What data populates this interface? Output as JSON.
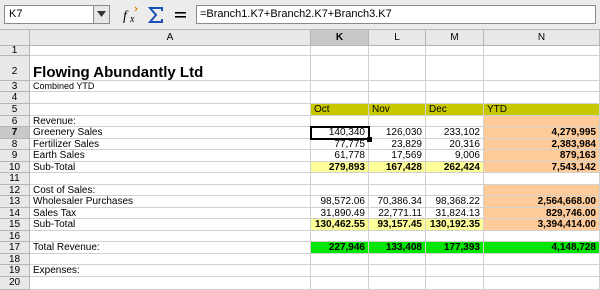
{
  "formula_bar": {
    "cell_ref": "K7",
    "formula": "=Branch1.K7+Branch2.K7+Branch3.K7",
    "icons": [
      "function-wizard-icon",
      "sum-icon",
      "equals-icon"
    ]
  },
  "colors": {
    "header_yellow": "#c8c800",
    "ytd_orange": "#ffcc99",
    "subtotal_yellow": "#ffff99",
    "total_green": "#00e600"
  },
  "columns": [
    "A",
    "K",
    "L",
    "M",
    "N"
  ],
  "rows": [
    "1",
    "2",
    "3",
    "4",
    "5",
    "6",
    "7",
    "8",
    "9",
    "10",
    "11",
    "12",
    "13",
    "14",
    "15",
    "16",
    "17",
    "18",
    "19",
    "20"
  ],
  "sheet": {
    "title": "Flowing Abundantly Ltd",
    "subtitle": "Combined YTD",
    "period_headers": [
      "Oct",
      "Nov",
      "Dec",
      "YTD"
    ],
    "revenue_label": "Revenue:",
    "revenue_rows": [
      {
        "label": "Greenery Sales",
        "k": "140,340",
        "l": "126,030",
        "m": "233,102",
        "n": "4,279,995"
      },
      {
        "label": "Fertilizer Sales",
        "k": "77,775",
        "l": "23,829",
        "m": "20,316",
        "n": "2,383,984"
      },
      {
        "label": "Earth Sales",
        "k": "61,778",
        "l": "17,569",
        "m": "9,006",
        "n": "879,163"
      }
    ],
    "revenue_subtotal": {
      "label": "Sub-Total",
      "k": "279,893",
      "l": "167,428",
      "m": "262,424",
      "n": "7,543,142"
    },
    "cost_label": "Cost of Sales:",
    "cost_rows": [
      {
        "label": "Wholesaler Purchases",
        "k": "98,572.06",
        "l": "70,386.34",
        "m": "98,368.22",
        "n": "2,564,668.00"
      },
      {
        "label": "Sales Tax",
        "k": "31,890.49",
        "l": "22,771.11",
        "m": "31,824.13",
        "n": "829,746.00"
      }
    ],
    "cost_subtotal": {
      "label": "Sub-Total",
      "k": "130,462.55",
      "l": "93,157.45",
      "m": "130,192.35",
      "n": "3,394,414.00"
    },
    "total_revenue": {
      "label": "Total Revenue:",
      "k": "227,946",
      "l": "133,408",
      "m": "177,393",
      "n": "4,148,728"
    },
    "expenses_label": "Expenses:"
  }
}
